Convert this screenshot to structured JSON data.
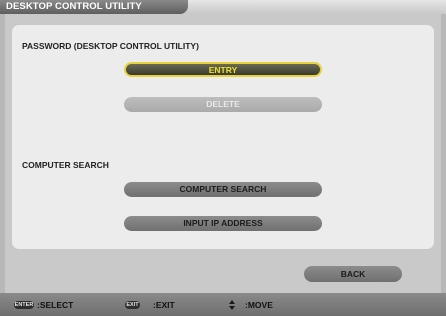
{
  "window": {
    "title": "DESKTOP CONTROL UTILITY"
  },
  "password_section": {
    "label": "PASSWORD (DESKTOP CONTROL UTILITY)",
    "entry_button": "ENTRY",
    "delete_button": "DELETE"
  },
  "search_section": {
    "label": "COMPUTER SEARCH",
    "computer_search_button": "COMPUTER SEARCH",
    "input_ip_button": "INPUT IP ADDRESS"
  },
  "footer": {
    "back_button": "BACK"
  },
  "status_bar": {
    "items": [
      {
        "key": "ENTER",
        "label": ":SELECT",
        "icon": "enter-key-icon"
      },
      {
        "key": "EXIT",
        "label": ":EXIT",
        "icon": "exit-key-icon"
      },
      {
        "key": "",
        "label": ":MOVE",
        "icon": "up-down-arrows-icon"
      }
    ]
  },
  "colors": {
    "selected_border": "#e8d23c",
    "selected_text": "#f0e02a",
    "panel_bg": "#ececec",
    "frame_bg": "#c9c9c9"
  }
}
